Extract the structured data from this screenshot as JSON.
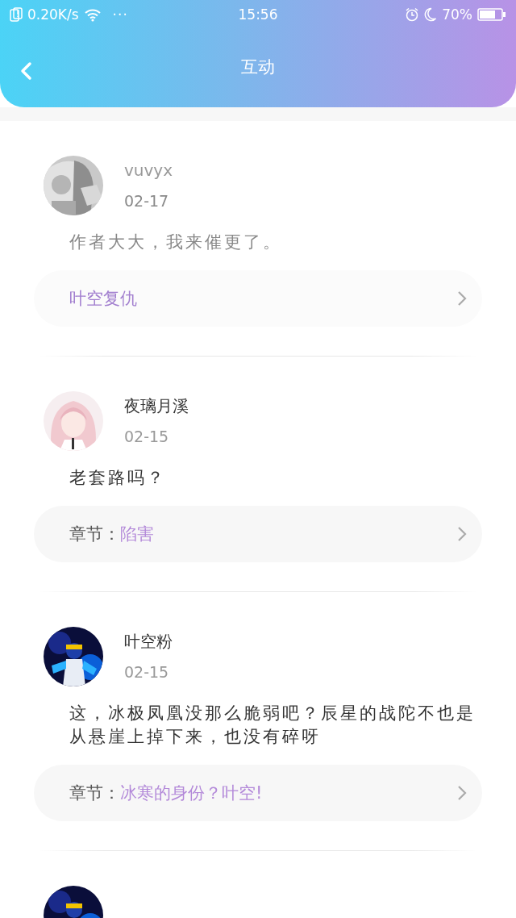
{
  "status_bar": {
    "speed": "0.20K/s",
    "more": "···",
    "time": "15:56",
    "battery_text": "70%"
  },
  "header": {
    "title": "互动"
  },
  "comments": [
    {
      "kind": "comment",
      "user": "vuvyx",
      "date": "02-17",
      "text": "作者大大，我来催更了。",
      "chapter": "叶空复仇",
      "faded": true
    },
    {
      "kind": "comment",
      "user": "夜璃月溪",
      "date": "02-15",
      "text": "老套路吗？",
      "chapter_prefix": "章节：",
      "chapter": "陷害",
      "faded": false
    },
    {
      "kind": "comment",
      "user": "叶空粉",
      "date": "02-15",
      "text": "这，冰极凤凰没那么脆弱吧？辰星的战陀不也是从悬崖上掉下来，也没有碎呀",
      "chapter_prefix": "章节：",
      "chapter": "冰寒的身份？叶空!",
      "faded": false
    },
    {
      "kind": "cut_off"
    }
  ]
}
